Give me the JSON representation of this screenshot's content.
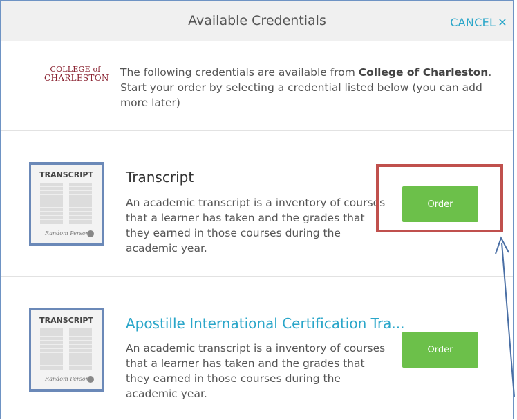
{
  "header": {
    "title": "Available Credentials",
    "cancel_label": "CANCEL",
    "cancel_icon": "✕"
  },
  "intro": {
    "logo_line1": "COLLEGE of",
    "logo_line2": "CHARLESTON",
    "text_before": "The following credentials are available from ",
    "institution": "College of Charleston",
    "text_after": ". Start your order by selecting a credential listed below (you can add more later)"
  },
  "credentials": [
    {
      "thumb_title": "TRANSCRIPT",
      "title": "Transcript",
      "description": "An academic transcript is a inventory of courses that a learner has taken and the grades that they earned in those courses during the academic year.",
      "button": "Order"
    },
    {
      "thumb_title": "TRANSCRIPT",
      "title": "Apostille International Certification Tra...",
      "description": "An academic transcript is a inventory of courses that a learner has taken and the grades that they earned in those courses during the academic year.",
      "button": "Order"
    }
  ],
  "colors": {
    "accent": "#2aa6c9",
    "order_button": "#6cc04a",
    "highlight": "#c0504d",
    "annotation_arrow": "#4a6fa5"
  }
}
